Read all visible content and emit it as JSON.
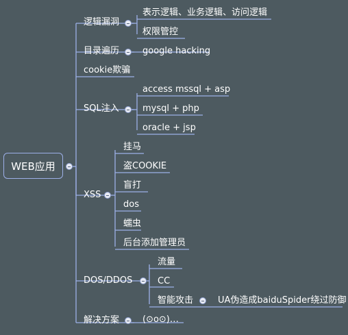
{
  "root": {
    "label": "WEB应用"
  },
  "branches": [
    {
      "label": "逻辑漏洞",
      "children": [
        {
          "label": "表示逻辑、业务逻辑、访问逻辑"
        },
        {
          "label": "权限管控"
        }
      ]
    },
    {
      "label": "目录遍历",
      "children": [
        {
          "label": "google hacking"
        }
      ]
    },
    {
      "label": "cookie欺骗",
      "children": []
    },
    {
      "label": "SQL注入",
      "children": [
        {
          "label": "access mssql + asp"
        },
        {
          "label": "mysql + php"
        },
        {
          "label": "oracle + jsp"
        }
      ]
    },
    {
      "label": "XSS",
      "children": [
        {
          "label": "挂马"
        },
        {
          "label": "盗COOKIE"
        },
        {
          "label": "盲打"
        },
        {
          "label": "dos"
        },
        {
          "label": "蠕虫"
        },
        {
          "label": "后台添加管理员"
        }
      ]
    },
    {
      "label": "DOS/DDOS",
      "children": [
        {
          "label": "流量"
        },
        {
          "label": "CC"
        },
        {
          "label": "智能攻击",
          "children": [
            {
              "label": "UA伪造成baiduSpider绕过防御"
            }
          ]
        }
      ]
    },
    {
      "label": "解决方案",
      "children": [
        {
          "label": "(⊙o⊙)…"
        }
      ]
    }
  ],
  "colors": {
    "background": "#4d5a60",
    "line": "#9db0e8",
    "text": "#ffffff",
    "collapse_button": "#e9ecf4"
  },
  "icons": {
    "collapse": "collapse-minus-icon"
  }
}
